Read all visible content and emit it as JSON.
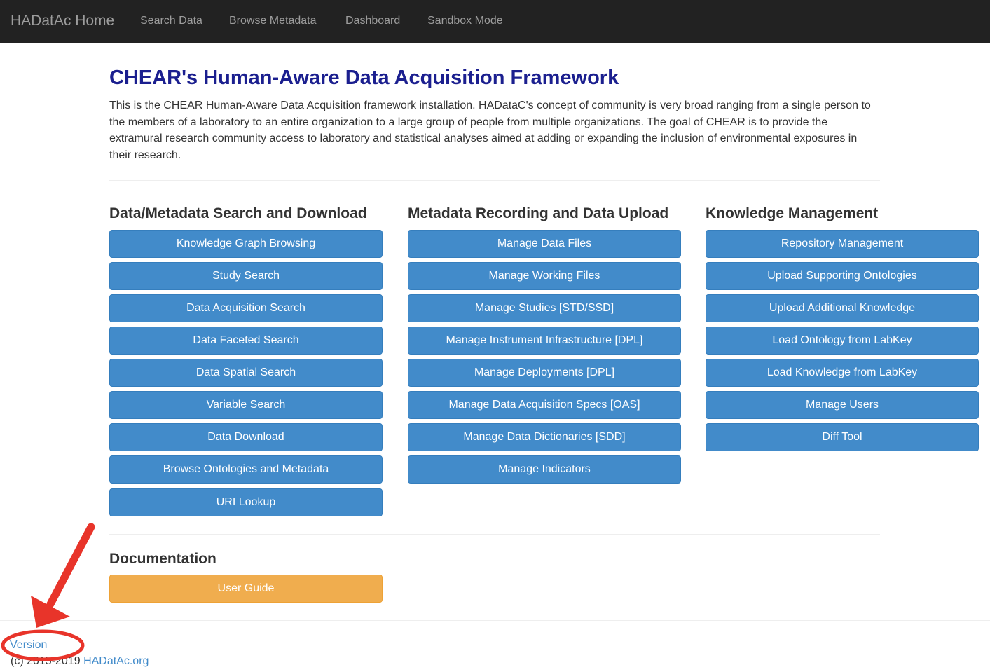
{
  "navbar": {
    "brand": "HADatAc Home",
    "links": [
      "Search Data",
      "Browse Metadata",
      "Dashboard",
      "Sandbox Mode"
    ]
  },
  "page": {
    "title": "CHEAR's Human-Aware Data Acquisition Framework",
    "intro": "This is the CHEAR Human-Aware Data Acquisition framework installation. HADatаC's concept of community is very broad ranging from a single person to the members of a laboratory to an entire organization to a large group of people from multiple organizations. The goal of CHEAR is to provide the extramural research community access to laboratory and statistical analyses aimed at adding or expanding the inclusion of environmental exposures in their research."
  },
  "sections": {
    "search": {
      "title": "Data/Metadata Search and Download",
      "buttons": [
        "Knowledge Graph Browsing",
        "Study Search",
        "Data Acquisition Search",
        "Data Faceted Search",
        "Data Spatial Search",
        "Variable Search",
        "Data Download",
        "Browse Ontologies and Metadata",
        "URI Lookup"
      ]
    },
    "recording": {
      "title": "Metadata Recording and Data Upload",
      "buttons": [
        "Manage Data Files",
        "Manage Working Files",
        "Manage Studies [STD/SSD]",
        "Manage Instrument Infrastructure [DPL]",
        "Manage Deployments [DPL]",
        "Manage Data Acquisition Specs [OAS]",
        "Manage Data Dictionaries [SDD]",
        "Manage Indicators"
      ]
    },
    "knowledge": {
      "title": "Knowledge Management",
      "buttons": [
        "Repository Management",
        "Upload Supporting Ontologies",
        "Upload Additional Knowledge",
        "Load Ontology from LabKey",
        "Load Knowledge from LabKey",
        "Manage Users",
        "Diff Tool"
      ]
    },
    "documentation": {
      "title": "Documentation",
      "user_guide": "User Guide"
    }
  },
  "footer": {
    "version": "Version",
    "copyright": "(c) 2015-2019 ",
    "site_link": "HADatAc.org"
  },
  "colors": {
    "navbar_bg": "#222222",
    "title": "#1b1f8f",
    "primary_button": "#428bca",
    "warning_button": "#f0ad4e",
    "annotation": "#e8342a"
  }
}
